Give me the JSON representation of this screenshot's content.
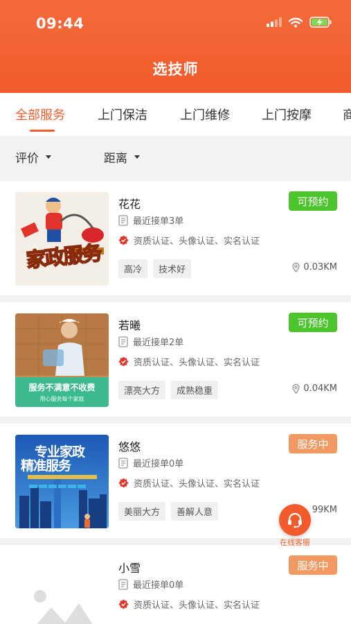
{
  "status_bar": {
    "time": "09:44"
  },
  "header": {
    "title": "选技师"
  },
  "tabs": [
    {
      "label": "全部服务",
      "active": true
    },
    {
      "label": "上门保洁"
    },
    {
      "label": "上门维修"
    },
    {
      "label": "上门按摩"
    },
    {
      "label": "商"
    }
  ],
  "filters": [
    {
      "label": "评价"
    },
    {
      "label": "距离"
    }
  ],
  "technicians": [
    {
      "name": "花花",
      "status": "可预约",
      "status_color": "#4cc42c",
      "orders": "最近接单3单",
      "certs": "资质认证、头像认证、实名认证",
      "tags": [
        "高冷",
        "技术好"
      ],
      "distance": "0.03KM",
      "image_text": "家政服务"
    },
    {
      "name": "若曦",
      "status": "可预约",
      "status_color": "#4cc42c",
      "orders": "最近接单2单",
      "certs": "资质认证、头像认证、实名认证",
      "tags": [
        "漂亮大方",
        "成熟稳重"
      ],
      "distance": "0.04KM",
      "image_banner": "服务不满意不收费",
      "image_sub": "用心服务每个家庭"
    },
    {
      "name": "悠悠",
      "status": "服务中",
      "status_color": "#f39a62",
      "orders": "最近接单0单",
      "certs": "资质认证、头像认证、实名认证",
      "tags": [
        "美丽大方",
        "善解人意"
      ],
      "distance": "99KM",
      "image_title_1": "专业家政",
      "image_title_2": "精准服务"
    },
    {
      "name": "小雪",
      "status": "服务中",
      "status_color": "#f39a62",
      "orders": "最近接单0单",
      "certs": "资质认证、头像认证、实名认证"
    }
  ],
  "float_button": {
    "label": "在线客服",
    "icon": "headset-icon"
  },
  "colors": {
    "primary": "#f25c2c",
    "available": "#4cc42c",
    "busy": "#f39a62"
  }
}
